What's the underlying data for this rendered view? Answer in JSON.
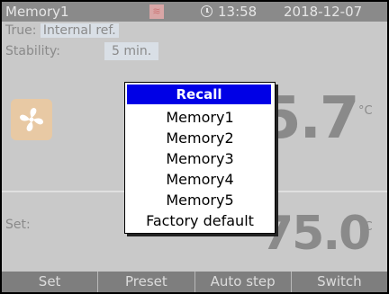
{
  "titlebar": {
    "title": "Memory1",
    "time": "13:58",
    "date": "2018-12-07"
  },
  "info": {
    "true_label": "True:",
    "true_value": "Internal ref.",
    "stability_label": "Stability:",
    "stability_value": "5 min."
  },
  "readouts": {
    "current_partial": "5.7",
    "set_label": "Set:",
    "set_partial": "75.0",
    "unit": "°C"
  },
  "dialog": {
    "title": "Recall",
    "items": [
      "Memory1",
      "Memory2",
      "Memory3",
      "Memory4",
      "Memory5",
      "Factory default"
    ]
  },
  "softkeys": [
    "Set",
    "Preset",
    "Auto step",
    "Switch"
  ],
  "colors": {
    "titlebar_bg": "#8a8a8a",
    "dialog_header": "#0000e6",
    "fan_tile": "#e8c9a4"
  }
}
